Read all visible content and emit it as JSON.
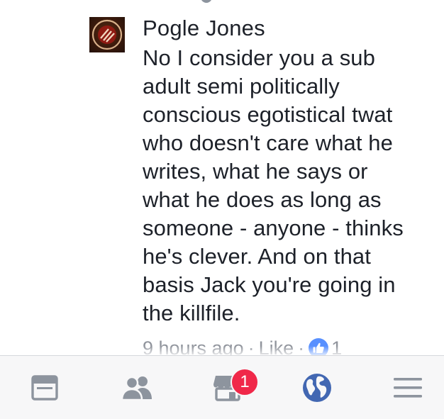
{
  "comment": {
    "author": "Pogle Jones",
    "text": "No I consider you a sub\nadult semi politically\nconscious egotistical twat\nwho doesn't care what he\nwrites, what he says or\nwhat he does as long as\nsomeone - anyone - thinks\nhe's clever. And on that\nbasis Jack you're going in\nthe killfile.",
    "time": "9 hours ago",
    "separator": "·",
    "like_label": "Like",
    "reaction_count": "1"
  },
  "tabbar": {
    "tabs": [
      {
        "name": "news-feed",
        "icon": "news-feed-icon",
        "active": false
      },
      {
        "name": "friends",
        "icon": "friends-icon",
        "active": false
      },
      {
        "name": "marketplace",
        "icon": "marketplace-icon",
        "active": false,
        "badge": "1"
      },
      {
        "name": "notifications",
        "icon": "globe-icon",
        "active": true
      },
      {
        "name": "menu",
        "icon": "menu-icon",
        "active": false
      }
    ],
    "colors": {
      "inactive": "#8d949e",
      "active": "#4267b2",
      "badge": "#f02849"
    }
  }
}
